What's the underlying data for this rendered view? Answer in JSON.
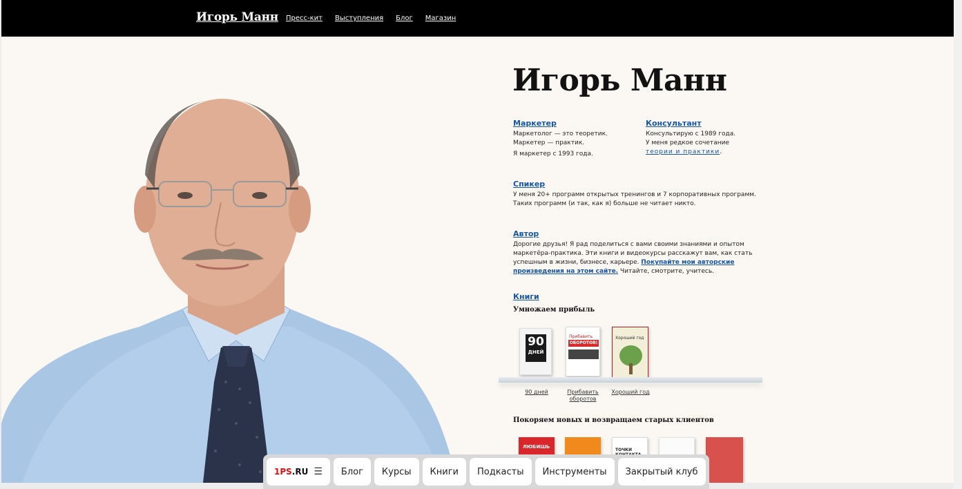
{
  "header": {
    "logo": "Игорь Манн",
    "nav": [
      "Пресс-кит",
      "Выступления",
      "Блог",
      "Магазин"
    ]
  },
  "hero": {
    "title": "Игорь Манн"
  },
  "sections": {
    "marketer": {
      "title": "Маркетер",
      "lines": [
        "Маркетолог — это теоретик.",
        "Маркетер — практик.",
        "Я маркетер с 1993 года."
      ]
    },
    "consultant": {
      "title": "Консультант",
      "lines": [
        "Консультирую с 1989 года.",
        "У меня редкое сочетание"
      ],
      "link": "теории и практики",
      "tail": "."
    },
    "speaker": {
      "title": "Спикер",
      "text": "У меня 20+ программ открытых тренингов и 7 корпоративных программ. Таких программ (и так, как я) больше не читает никто."
    },
    "author": {
      "title": "Автор",
      "text": "Дорогие друзья! Я рад поделиться с вами своими знаниями и опытом маркетёра-практика. Эти книги и видеокурсы расскажут вам, как стать успешным в жизни, бизнесе, карьере.",
      "link": "Покупайте мои авторские произведения на этом сайте.",
      "tail": " Читайте, смотрите, учитесь."
    },
    "books": {
      "title": "Книги",
      "group1": "Умножаем прибыль",
      "group1_books": [
        "90 дней",
        "Прибавить оборотов",
        "Хороший год"
      ],
      "group1_cover_text": [
        "90",
        "ДНЕЙ",
        "Прибавить",
        "ОБОРОТОВ!",
        "Хороший год"
      ],
      "group2": "Покоряем новых и возвращаем старых клиентов",
      "group2_cover_text": [
        "ЛЮБИШЬ",
        "ТОЧКИ КОНТАКТА"
      ]
    }
  },
  "bottom_nav": {
    "brand_1ps": "1PS",
    "brand_ru": ".RU",
    "items": [
      "Блог",
      "Курсы",
      "Книги",
      "Подкасты",
      "Инструменты",
      "Закрытый клуб"
    ]
  },
  "colors": {
    "accent_link": "#1656a5",
    "page_bg": "#fbf8f3",
    "header_bg": "#000000",
    "brand_red": "#dd1111"
  }
}
